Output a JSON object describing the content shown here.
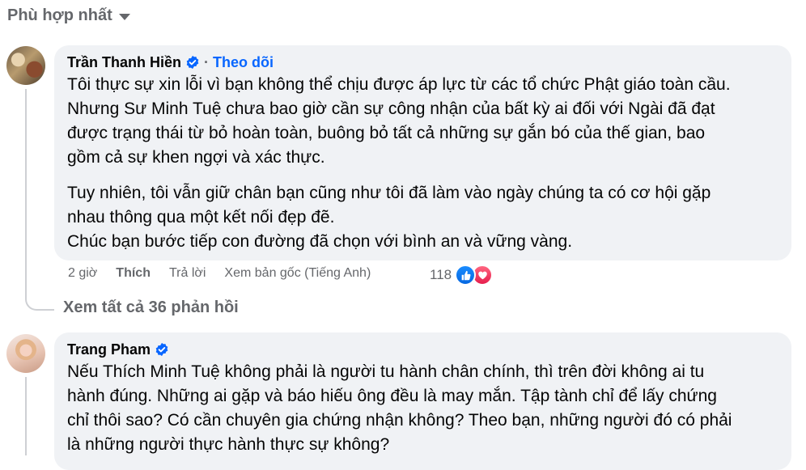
{
  "sort": {
    "label": "Phù hợp nhất"
  },
  "comments": [
    {
      "author": "Trần Thanh Hiền",
      "verified": true,
      "follow_separator": "·",
      "follow_label": "Theo dõi",
      "paragraphs": [
        "Tôi thực sự xin lỗi vì bạn không thể chịu được áp lực từ các tổ chức Phật giáo toàn cầu.",
        "Nhưng Sư Minh Tuệ chưa bao giờ cần sự công nhận của bất kỳ ai đối với Ngài đã đạt",
        "được trạng thái từ bỏ hoàn toàn, buông bỏ tất cả những sự gắn bó của thế gian, bao",
        "gồm cả sự khen ngợi và xác thực."
      ],
      "paragraphs2": [
        "Tuy nhiên, tôi vẫn giữ chân bạn cũng như tôi đã làm vào ngày chúng ta có cơ hội gặp",
        "nhau thông qua một kết nối đẹp đẽ.",
        "Chúc bạn bước tiếp con đường đã chọn với bình an và vững vàng."
      ],
      "time": "2 giờ",
      "like_label": "Thích",
      "reply_label": "Trả lời",
      "see_original_label": "Xem bản gốc (Tiếng Anh)",
      "reaction_count": "118",
      "reactions": [
        "like-icon",
        "love-icon"
      ],
      "view_replies_label": "Xem tất cả 36 phản hồi"
    },
    {
      "author": "Trang Pham",
      "verified": true,
      "paragraphs": [
        "Nếu Thích Minh Tuệ không phải là người tu hành chân chính, thì trên đời không ai tu",
        "hành đúng. Những ai gặp và báo hiếu ông đều là may mắn. Tập tành chỉ để lấy chứng",
        "chỉ thôi sao? Có cần chuyên gia chứng nhận không? Theo bạn, những người đó có phải",
        "là những người thực hành thực sự không?"
      ]
    }
  ],
  "colors": {
    "accent": "#0866ff",
    "bubble": "#f0f2f5",
    "muted": "#65676b",
    "line": "#ced0d4"
  }
}
